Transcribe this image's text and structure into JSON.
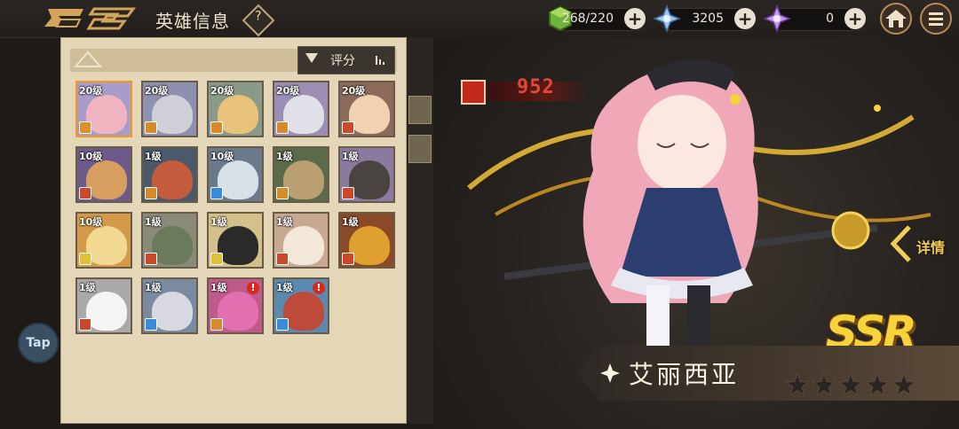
{
  "header": {
    "title": "英雄信息",
    "help_glyph": "?",
    "resources": [
      {
        "name": "stamina",
        "icon": "green-cube-icon",
        "value": "268/220"
      },
      {
        "name": "crystal",
        "icon": "blue-crystal-icon",
        "value": "3205"
      },
      {
        "name": "purple_crystal",
        "icon": "purple-crystal-icon",
        "value": "0"
      }
    ],
    "plus_glyph": "+"
  },
  "panel": {
    "sort_label": "评分"
  },
  "heroes": [
    {
      "level": "20级",
      "selected": true,
      "class_color": "#e0902a",
      "face": "#f0b4c0",
      "bg": "#a99cc8"
    },
    {
      "level": "20级",
      "selected": false,
      "class_color": "#d58b2b",
      "face": "#cfcfd8",
      "bg": "#8f8faf"
    },
    {
      "level": "20级",
      "selected": false,
      "class_color": "#d58b2b",
      "face": "#e8c27a",
      "bg": "#8a9a88"
    },
    {
      "level": "20级",
      "selected": false,
      "class_color": "#d58b2b",
      "face": "#e0e0e8",
      "bg": "#9b8db4"
    },
    {
      "level": "20级",
      "selected": false,
      "class_color": "#c84a2a",
      "face": "#f0d2b0",
      "bg": "#8a6a5a"
    },
    {
      "level": "10级",
      "selected": false,
      "class_color": "#c84a2a",
      "face": "#d7a060",
      "bg": "#6b5a8a"
    },
    {
      "level": "1级",
      "selected": false,
      "class_color": "#d58b2b",
      "face": "#c45b3c",
      "bg": "#4a5a6a"
    },
    {
      "level": "10级",
      "selected": false,
      "class_color": "#3a8ad8",
      "face": "#d8e0e8",
      "bg": "#6a7a8a"
    },
    {
      "level": "1级",
      "selected": false,
      "class_color": "#d58b2b",
      "face": "#b8a070",
      "bg": "#5a6a4a"
    },
    {
      "level": "1级",
      "selected": false,
      "class_color": "#c84a2a",
      "face": "#4a4440",
      "bg": "#8a7aa0"
    },
    {
      "level": "10级",
      "selected": false,
      "class_color": "#e0c03a",
      "face": "#f2d890",
      "bg": "#d49a4a"
    },
    {
      "level": "1级",
      "selected": false,
      "class_color": "#c84a2a",
      "face": "#6a7a5a",
      "bg": "#8a8a7a"
    },
    {
      "level": "1级",
      "selected": false,
      "class_color": "#e0c03a",
      "face": "#2a2a2a",
      "bg": "#d4c08a"
    },
    {
      "level": "1级",
      "selected": false,
      "class_color": "#c84a2a",
      "face": "#f2e8d8",
      "bg": "#c8a890"
    },
    {
      "level": "1级",
      "selected": false,
      "class_color": "#c84a2a",
      "face": "#e0a030",
      "bg": "#8a4a2a"
    },
    {
      "level": "1级",
      "selected": false,
      "class_color": "#c84a2a",
      "face": "#f4f4f4",
      "bg": "#a9a9a9"
    },
    {
      "level": "1级",
      "selected": false,
      "class_color": "#3a8ad8",
      "face": "#d8d8e0",
      "bg": "#7a8aa0"
    },
    {
      "level": "1级",
      "selected": false,
      "class_color": "#d58b2b",
      "face": "#e070b0",
      "bg": "#c05a8a",
      "alert": "!"
    },
    {
      "level": "1级",
      "selected": false,
      "class_color": "#3a8ad8",
      "face": "#c04a3a",
      "bg": "#5a8ab0",
      "alert": "!"
    }
  ],
  "hero": {
    "power": "952",
    "detail_label": "详情",
    "rarity": "SSR",
    "name": "艾丽西亚",
    "stars": 5
  },
  "tap_button": "Tap"
}
